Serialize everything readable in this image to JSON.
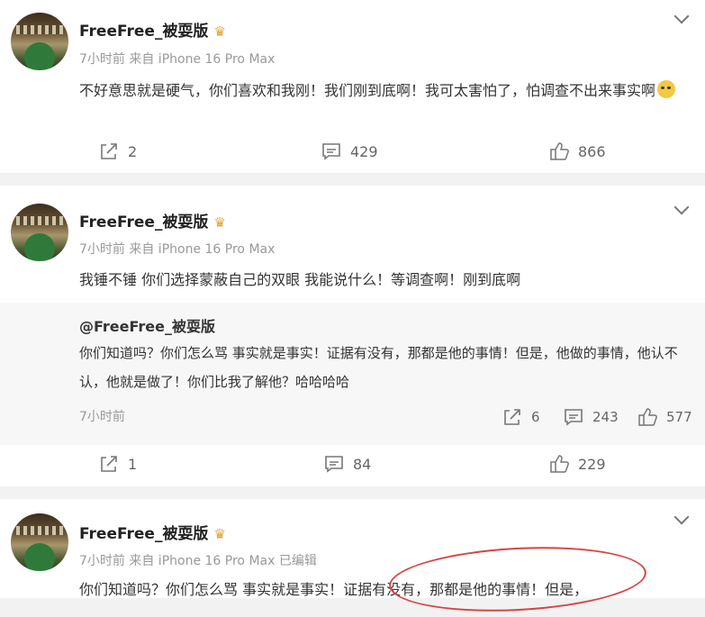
{
  "posts": [
    {
      "username": "FreeFree_被耍版",
      "meta": "7小时前 来自 iPhone 16 Pro Max",
      "text": "不好意思就是硬气，你们喜欢和我刚！我们刚到底啊！我可太害怕了，怕调查不出来事实啊",
      "reposts": "2",
      "comments": "429",
      "likes": "866"
    },
    {
      "username": "FreeFree_被耍版",
      "meta": "7小时前 来自 iPhone 16 Pro Max",
      "text": "我锤不锤 你们选择蒙蔽自己的双眼 我能说什么！等调查啊！刚到底啊",
      "quote": {
        "user": "@FreeFree_被耍版",
        "text": "你们知道吗？你们怎么骂 事实就是事实！证据有没有，那都是他的事情！但是，他做的事情，他认不认，他就是做了！你们比我了解他？哈哈哈哈",
        "time": "7小时前",
        "reposts": "6",
        "comments": "243",
        "likes": "577"
      },
      "reposts": "1",
      "comments": "84",
      "likes": "229"
    },
    {
      "username": "FreeFree_被耍版",
      "meta": "7小时前 来自 iPhone 16 Pro Max 已编辑",
      "text": "你们知道吗？你们怎么骂 事实就是事实！证据有没有，那都是他的事情！但是，"
    }
  ],
  "icons": {
    "repost": "repost-icon",
    "comment": "comment-icon",
    "like": "like-icon",
    "menu": "chevron-down-icon",
    "badge": "crown-icon"
  },
  "colors": {
    "annotation": "#d64545",
    "badge": "#e0a33a"
  }
}
